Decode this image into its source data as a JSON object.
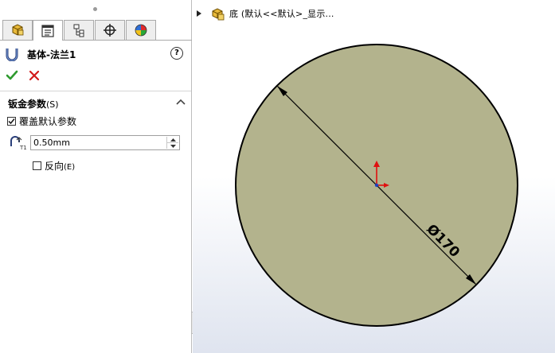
{
  "panel": {
    "tabs": [
      {
        "name": "feature-manager",
        "icon": "part-tree-icon"
      },
      {
        "name": "property-manager",
        "icon": "property-list-icon"
      },
      {
        "name": "configuration-manager",
        "icon": "configuration-icon"
      },
      {
        "name": "dimxpert-manager",
        "icon": "crosshair-icon"
      },
      {
        "name": "display-manager",
        "icon": "appearance-sphere-icon"
      }
    ],
    "feature": {
      "title": "基体-法兰1",
      "icon": "base-flange-icon",
      "help_label": "?"
    },
    "actions": {
      "ok_icon": "checkmark-icon",
      "cancel_icon": "x-icon",
      "ok_color": "#2e9a2e",
      "cancel_color": "#d21a1a"
    },
    "sheet_metal_params": {
      "title": "钣金参数",
      "title_suffix": "(S)",
      "override_default": {
        "label": "覆盖默认参数",
        "checked": true
      },
      "thickness": {
        "value": "0.50mm"
      },
      "reverse": {
        "label": "反向",
        "suffix": "(E)",
        "checked": false
      }
    }
  },
  "viewport": {
    "tree_label": "底 (默认<<默认>_显示...",
    "model_fill": "#b3b38d",
    "dimension": {
      "symbol": "Ø",
      "value": "170"
    },
    "origin_colors": {
      "x_axis": "#e01010",
      "y_axis": "#e01010"
    }
  }
}
